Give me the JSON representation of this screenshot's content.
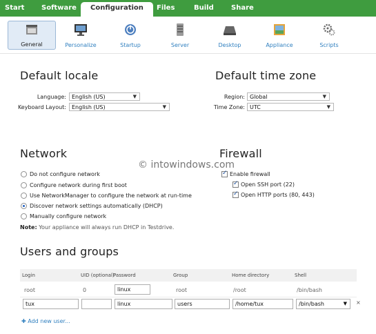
{
  "nav": {
    "tabs": [
      "Start",
      "Software",
      "Configuration",
      "Files",
      "Build",
      "Share"
    ],
    "active": "Configuration"
  },
  "toolbar": {
    "items": [
      {
        "label": "General",
        "icon": "general-icon"
      },
      {
        "label": "Personalize",
        "icon": "monitor-icon"
      },
      {
        "label": "Startup",
        "icon": "power-icon"
      },
      {
        "label": "Server",
        "icon": "server-icon"
      },
      {
        "label": "Desktop",
        "icon": "desktop-icon"
      },
      {
        "label": "Appliance",
        "icon": "appliance-icon"
      },
      {
        "label": "Scripts",
        "icon": "gears-icon"
      }
    ],
    "active": "General"
  },
  "locale": {
    "title": "Default locale",
    "language_label": "Language:",
    "language_value": "English (US)",
    "keyboard_label": "Keyboard Layout:",
    "keyboard_value": "English (US)"
  },
  "timezone": {
    "title": "Default time zone",
    "region_label": "Region:",
    "region_value": "Global",
    "zone_label": "Time Zone:",
    "zone_value": "UTC"
  },
  "network": {
    "title": "Network",
    "options": [
      "Do not configure network",
      "Configure network during first boot",
      "Use NetworkManager to configure the network at run-time",
      "Discover network settings automatically (DHCP)",
      "Manually configure network"
    ],
    "selected_index": 3,
    "note_label": "Note:",
    "note_text": "Your appliance will always run DHCP in Testdrive."
  },
  "firewall": {
    "title": "Firewall",
    "enable_label": "Enable firewall",
    "ssh_label": "Open SSH port (22)",
    "http_label": "Open HTTP ports (80, 443)"
  },
  "watermark": "© intowindows.com",
  "users": {
    "title": "Users and groups",
    "columns": [
      "Login",
      "UID (optional)",
      "Password",
      "Group",
      "Home directory",
      "Shell"
    ],
    "root_row": {
      "login": "root",
      "uid": "0",
      "password": "linux",
      "group": "root",
      "home": "/root",
      "shell": "/bin/bash"
    },
    "tux_row": {
      "login": "tux",
      "uid": "",
      "password": "linux",
      "group": "users",
      "home": "/home/tux",
      "shell": "/bin/bash"
    },
    "remove_glyph": "×",
    "add_label": "Add new user..."
  }
}
